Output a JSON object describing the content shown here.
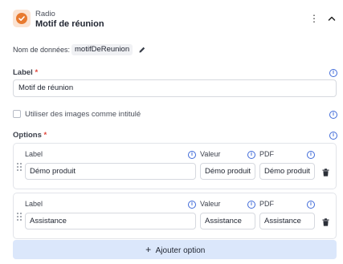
{
  "header": {
    "type_label": "Radio",
    "title": "Motif de réunion",
    "icon": "check-circle-icon",
    "accent_color": "#e87a2f"
  },
  "data_name": {
    "label": "Nom de données:",
    "value": "motifDeReunion"
  },
  "label_field": {
    "label": "Label",
    "required_mark": "*",
    "value": "Motif de réunion"
  },
  "use_images": {
    "label": "Utiliser des images comme intitulé",
    "checked": false
  },
  "options": {
    "title": "Options",
    "required_mark": "*",
    "columns": {
      "label": "Label",
      "value": "Valeur",
      "pdf": "PDF"
    },
    "items": [
      {
        "label": "Démo produit",
        "value": "Démo produit",
        "pdf": "Démo produit"
      },
      {
        "label": "Assistance",
        "value": "Assistance",
        "pdf": "Assistance"
      }
    ],
    "add_label": "Ajouter option"
  }
}
